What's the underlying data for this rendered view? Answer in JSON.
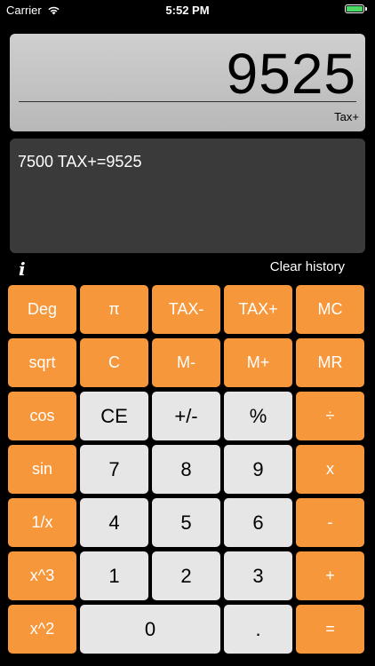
{
  "status_bar": {
    "carrier": "Carrier",
    "time": "5:52 PM",
    "battery_level": 1.0,
    "battery_color": "#4cd964"
  },
  "display": {
    "value": "9525",
    "mode": "Tax+"
  },
  "history": {
    "entries": [
      "7500 TAX+=9525"
    ]
  },
  "info": {
    "icon_label": "i",
    "clear_history_label": "Clear history"
  },
  "keypad": {
    "row1": [
      "Deg",
      "π",
      "TAX-",
      "TAX+",
      "MC"
    ],
    "row2": [
      "sqrt",
      "C",
      "M-",
      "M+",
      "MR"
    ],
    "row3": [
      "cos",
      "CE",
      "+/-",
      "%",
      "÷"
    ],
    "row4": [
      "sin",
      "7",
      "8",
      "9",
      "x"
    ],
    "row5": [
      "1/x",
      "4",
      "5",
      "6",
      "-"
    ],
    "row6": [
      "x^3",
      "1",
      "2",
      "3",
      "+"
    ],
    "row7": [
      "x^2",
      "0",
      ".",
      "="
    ]
  },
  "colors": {
    "function_key": "#f7973b",
    "digit_key": "#e6e6e6",
    "display_bg": "#c4c4c4",
    "history_bg": "#3a3a3a",
    "background": "#000000"
  }
}
